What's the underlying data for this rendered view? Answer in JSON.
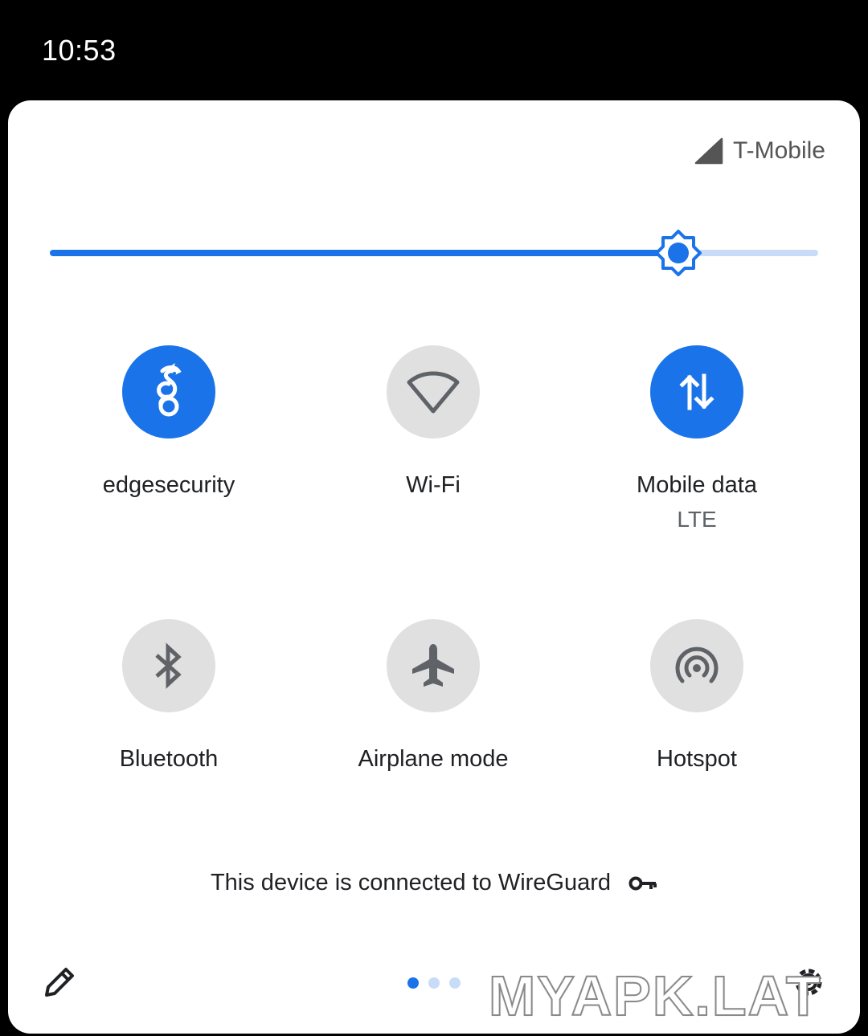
{
  "status_bar": {
    "time": "10:53"
  },
  "panel": {
    "carrier": {
      "name": "T-Mobile",
      "icon": "cell-signal-icon"
    },
    "brightness": {
      "level": 0.818,
      "icon": "brightness-icon"
    },
    "tiles": [
      {
        "id": "edgesecurity",
        "label": "edgesecurity",
        "sublabel": "",
        "state": "on",
        "icon": "wireguard-dragon-icon"
      },
      {
        "id": "wifi",
        "label": "Wi-Fi",
        "sublabel": "",
        "state": "off",
        "icon": "wifi-icon"
      },
      {
        "id": "mobile-data",
        "label": "Mobile data",
        "sublabel": "LTE",
        "state": "on",
        "icon": "mobile-data-arrows-icon"
      },
      {
        "id": "bluetooth",
        "label": "Bluetooth",
        "sublabel": "",
        "state": "off",
        "icon": "bluetooth-icon"
      },
      {
        "id": "airplane",
        "label": "Airplane mode",
        "sublabel": "",
        "state": "off",
        "icon": "airplane-icon"
      },
      {
        "id": "hotspot",
        "label": "Hotspot",
        "sublabel": "",
        "state": "off",
        "icon": "hotspot-icon"
      }
    ],
    "vpn_message": "This device is connected to WireGuard",
    "vpn_icon": "key-icon",
    "page_indicator": {
      "count": 3,
      "active": 0
    },
    "edit_icon": "pencil-icon",
    "settings_icon": "gear-icon"
  },
  "watermark": "MYAPK.LAT",
  "colors": {
    "accent": "#1a73e8",
    "accent_light": "#c8dcf8",
    "tile_off": "#e0e0e0",
    "icon_off": "#5f6368"
  }
}
